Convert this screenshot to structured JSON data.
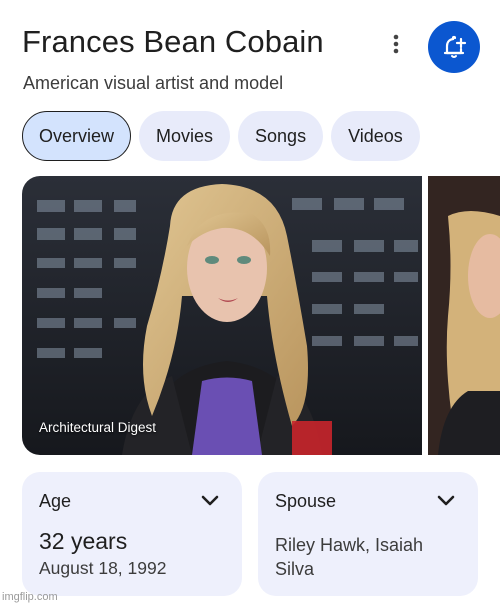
{
  "header": {
    "title": "Frances Bean Cobain",
    "subtitle": "American visual artist and model"
  },
  "tabs": [
    {
      "label": "Overview",
      "active": true
    },
    {
      "label": "Movies",
      "active": false
    },
    {
      "label": "Songs",
      "active": false
    },
    {
      "label": "Videos",
      "active": false
    }
  ],
  "images": {
    "main_caption": "Architectural Digest"
  },
  "cards": {
    "age": {
      "label": "Age",
      "value": "32 years",
      "detail": "August 18, 1992"
    },
    "spouse": {
      "label": "Spouse",
      "value": "Riley Hawk, Isaiah Silva"
    }
  },
  "watermark": "imgflip.com",
  "colors": {
    "accent": "#0b57d0",
    "chip_bg": "#e8ebfa",
    "chip_active_bg": "#d3e3fd",
    "card_bg": "#eef0fc"
  },
  "icons": {
    "more": "more-vert-icon",
    "follow": "add-alert-icon",
    "expand": "chevron-down-icon"
  }
}
